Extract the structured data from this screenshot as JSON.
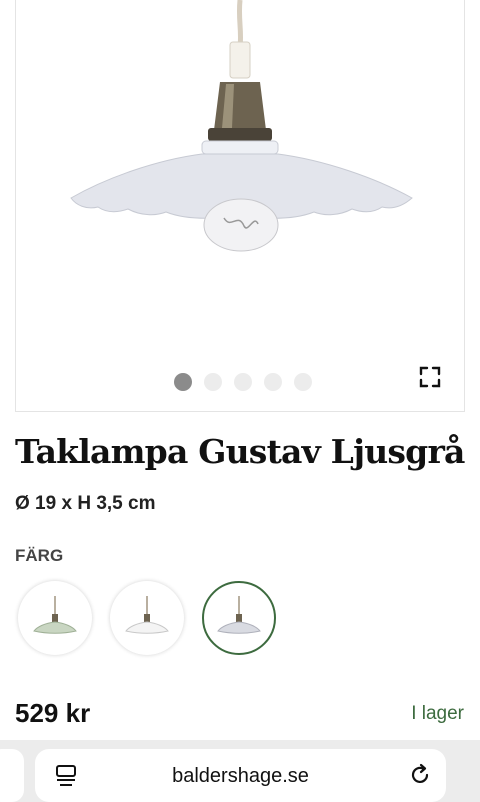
{
  "product": {
    "title": "Taklampa Gustav Ljusgrå",
    "dimensions": "Ø 19 x H 3,5 cm",
    "color_label": "FÄRG",
    "price": "529 kr",
    "stock_status": "I lager"
  },
  "gallery": {
    "image_count": 5,
    "active_index": 0,
    "icon": "fullscreen-icon"
  },
  "swatches": [
    {
      "name": "sage-green",
      "color": "#c9d6c2",
      "selected": false
    },
    {
      "name": "white",
      "color": "#f2f2f2",
      "selected": false
    },
    {
      "name": "light-grey",
      "color": "#d9dbe2",
      "selected": true
    }
  ],
  "browser": {
    "url": "baldershage.se",
    "menu_icon": "page-menu-icon",
    "reload_icon": "reload-icon"
  },
  "colors": {
    "accent_green": "#3d6b3f",
    "dot_active": "#8b8b8b",
    "dot_inactive": "#ececec"
  }
}
